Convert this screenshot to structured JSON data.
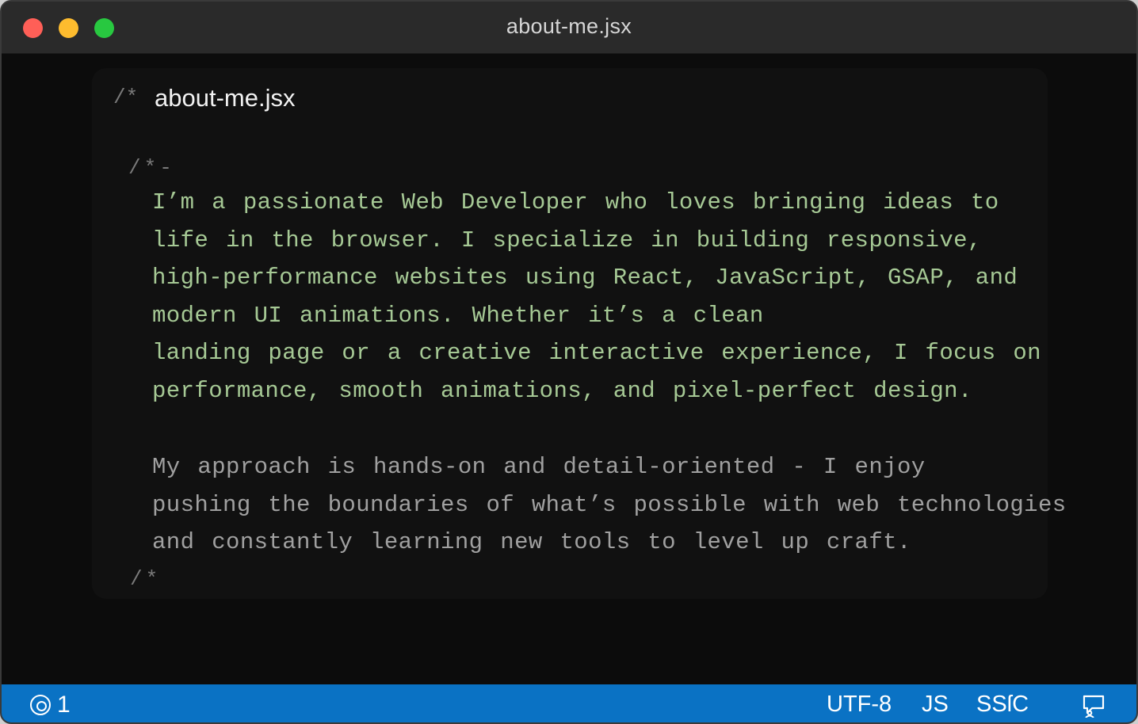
{
  "window": {
    "title": "about-me.jsx"
  },
  "editor": {
    "header": {
      "comment_mark": "/*",
      "filename": "about-me.jsx"
    },
    "open_comment": "/*-",
    "paragraph1": {
      "lines": [
        "I’m a passionate Web Developer who loves bringing ideas to",
        "life in the browser. I specialize in building responsive,",
        "high-performance websites using React, JavaScript, GSAP, and",
        "modern UI animations. Whether it’s a clean",
        "landing page or a creative interactive experience, I focus on",
        "performance, smooth animations, and pixel-perfect design."
      ]
    },
    "paragraph2": {
      "lines": [
        "My approach is hands-on and detail-oriented - I enjoy",
        "pushing the boundaries of what’s possible with web technologies",
        "and constantly learning new tools to level up craft."
      ]
    },
    "close_comment": "/*"
  },
  "statusbar": {
    "problems_count": "1",
    "encoding": "UTF-8",
    "language": "JS",
    "mode": "SSſC",
    "icons": [
      "broadcast-icon",
      "feedback-icon"
    ]
  },
  "colors": {
    "statusbar_bg": "#0a72c4",
    "comment_green": "#a6c995",
    "comment_gray": "#a0a0a0",
    "close_red": "#ff5f57",
    "minimize_yellow": "#febc2e",
    "maximize_green": "#28c840"
  }
}
